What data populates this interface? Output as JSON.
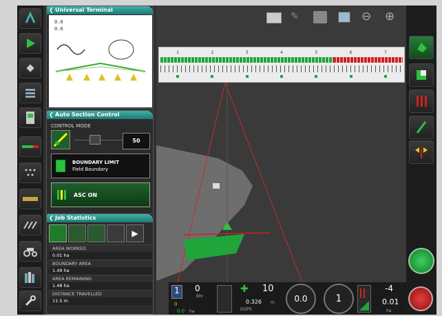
{
  "colors": {
    "accent": "#3fb0a8",
    "green": "#1fa53a",
    "red": "#d02020",
    "map_bg": "#3a3a3a",
    "field": "#6e6e6e"
  },
  "left_icons": [
    "autosteer-icon",
    "play-icon",
    "satellite-icon",
    "list-icon",
    "device-icon",
    "implement-icon",
    "sprayer-icon",
    "seeder-icon",
    "pattern-icon",
    "tractor-icon",
    "books-icon",
    "wrench-icon"
  ],
  "ut_panel": {
    "title": "Universal Terminal",
    "row1": "0.0",
    "row2": "0.0"
  },
  "asc_panel": {
    "title": "Auto Section Control",
    "control_mode_label": "CONTROL MODE",
    "control_value": "50",
    "boundary_title": "BOUNDARY LIMIT",
    "boundary_sub": "Field Boundary",
    "asc_status": "ASC ON"
  },
  "job_panel": {
    "title": "Job Statistics",
    "stats": [
      {
        "label": "AREA WORKED",
        "value": "0.01 ha"
      },
      {
        "label": "BOUNDARY AREA",
        "value": "1.49 ha"
      },
      {
        "label": "AREA REMAINING",
        "value": "1.48 ha"
      },
      {
        "label": "DISTANCE TRAVELLED",
        "value": "11.5 m"
      }
    ]
  },
  "boom": {
    "section_numbers": [
      "1",
      "2",
      "3",
      "4",
      "5",
      "6",
      "7"
    ]
  },
  "status_bar": {
    "tracker_number": "1",
    "count_value": "0",
    "count_unit": "Bhr",
    "sub_value1": "0",
    "sub_value2": "0.0",
    "sub_unit2": "ha",
    "gps_value": "10",
    "gps_speed": "0.326",
    "gps_speed_unit": "m",
    "gps_mode": "DGPS",
    "gauge1_value": "0.0",
    "gauge2_value": "1",
    "offset_value": "-4",
    "offset2_value": "0.01",
    "offset2_unit": "ha"
  }
}
